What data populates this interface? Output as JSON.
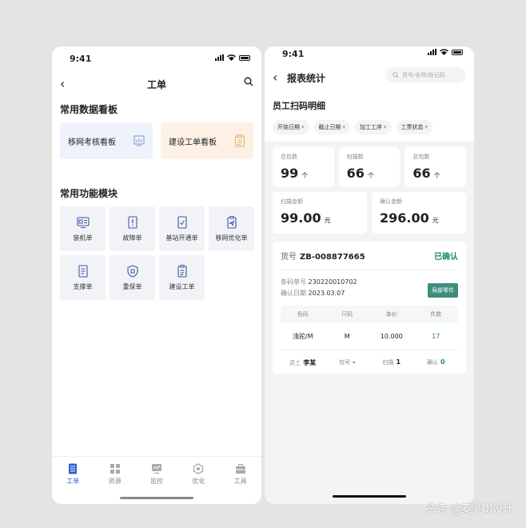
{
  "left": {
    "status_time": "9:41",
    "nav_title": "工单",
    "section1_title": "常用数据看板",
    "boards": [
      {
        "label": "移网考核看板",
        "icon": "chart-icon"
      },
      {
        "label": "建设工单看板",
        "icon": "clipboard-icon"
      }
    ],
    "section2_title": "常用功能模块",
    "modules": [
      {
        "label": "装机单"
      },
      {
        "label": "故障单"
      },
      {
        "label": "基站开通单"
      },
      {
        "label": "移网优化单"
      },
      {
        "label": "支撑单"
      },
      {
        "label": "重保单"
      },
      {
        "label": "建设工单"
      }
    ],
    "tabs": [
      {
        "label": "工单",
        "active": true
      },
      {
        "label": "资源"
      },
      {
        "label": "监控"
      },
      {
        "label": "优化"
      },
      {
        "label": "工具"
      }
    ]
  },
  "right": {
    "status_time": "9:41",
    "nav_title": "报表统计",
    "search_placeholder": "货号/名称/助记码",
    "subtitle": "员工扫码明细",
    "filters": [
      "开始日期",
      "截止日期",
      "加工工序",
      "工票状态"
    ],
    "stats": [
      {
        "label": "总包数",
        "value": "99",
        "unit": "个"
      },
      {
        "label": "扫描数",
        "value": "66",
        "unit": "个"
      },
      {
        "label": "总包数",
        "value": "66",
        "unit": "个"
      }
    ],
    "amounts": [
      {
        "label": "扫描金额",
        "value": "99.00",
        "unit": "元"
      },
      {
        "label": "确认金额",
        "value": "296.00",
        "unit": "元"
      }
    ],
    "card": {
      "no_label": "货号",
      "no_value": "ZB-008877665",
      "status": "已确认",
      "barcode_label": "条码单号",
      "barcode_value": "230220010702",
      "date_label": "确认日期",
      "date_value": "2023.03.07",
      "tag": "局部零件",
      "headers": [
        "色码",
        "尺码",
        "单价",
        "件数"
      ],
      "row": [
        "浅驼/M",
        "M",
        "10.000",
        "17"
      ],
      "footer": {
        "employee_label": "员工",
        "employee_value": "李某",
        "pack_label": "包号",
        "pack_value": "-",
        "scan_label": "扫描",
        "scan_value": "1",
        "confirm_label": "确认",
        "confirm_value": "0"
      }
    }
  },
  "watermark": "头条 @麦灵UI设计",
  "colors": {
    "accent": "#2f5fd9",
    "success": "#1d8a6d",
    "tag": "#3e8e7e"
  }
}
